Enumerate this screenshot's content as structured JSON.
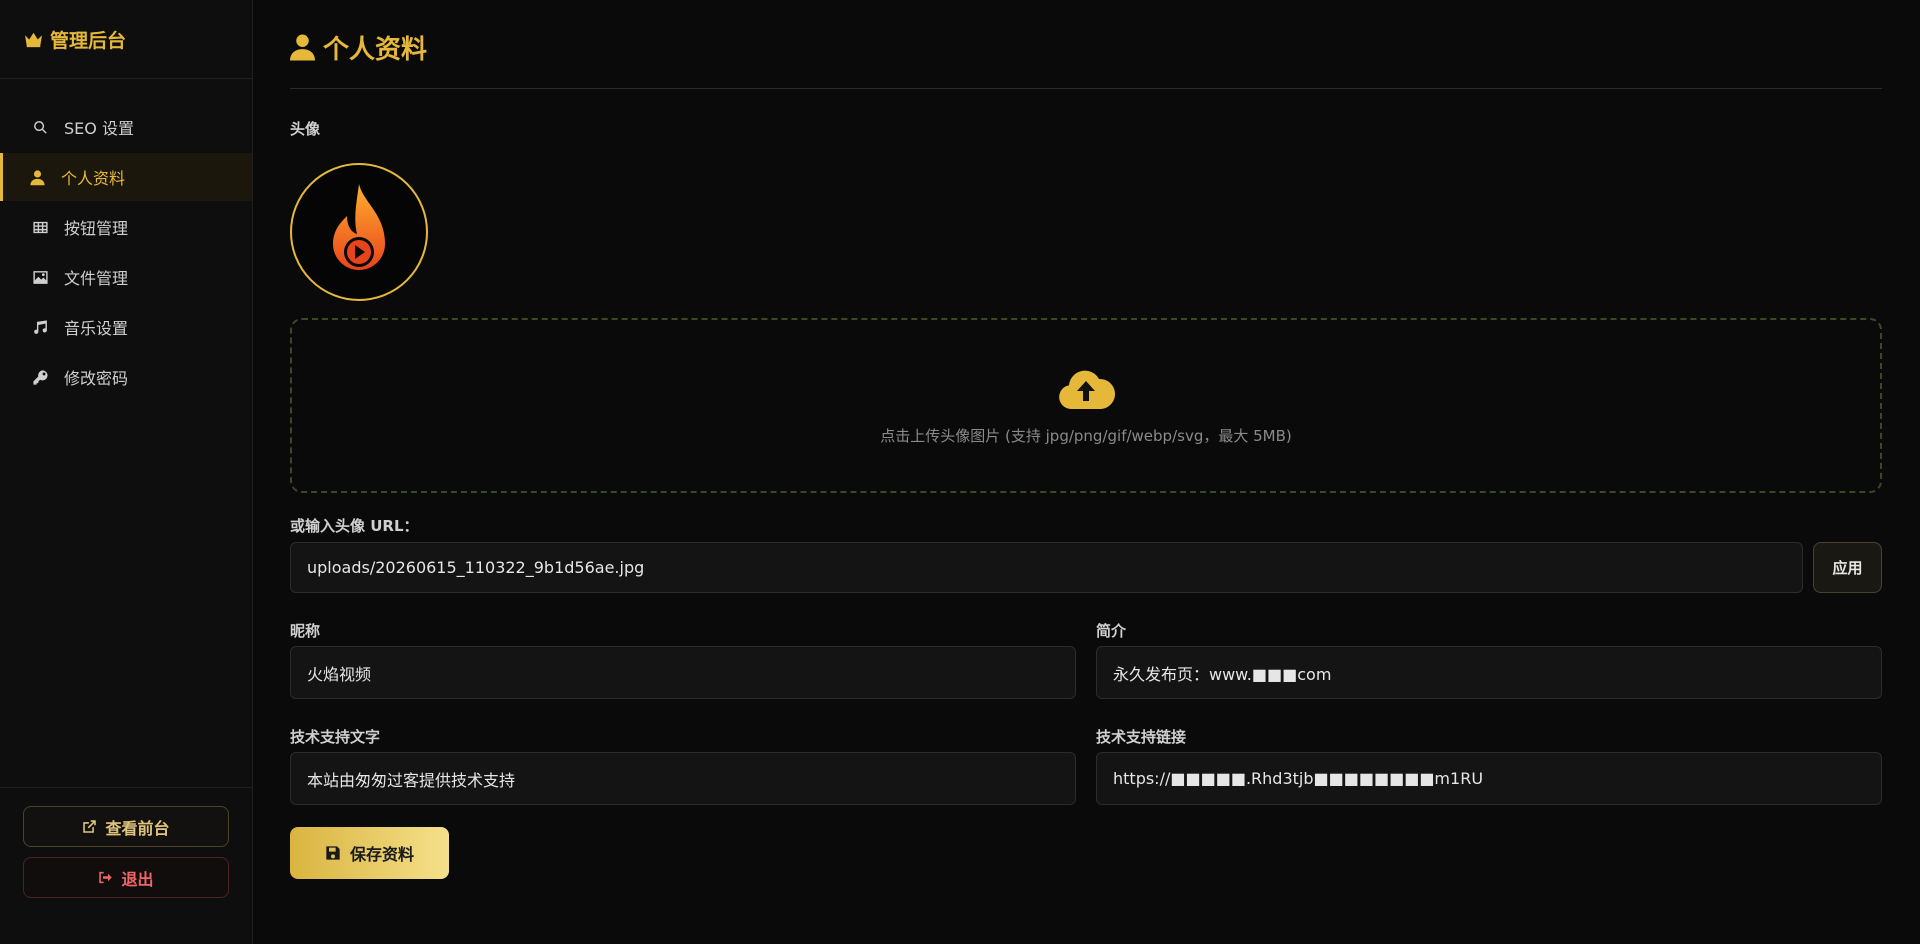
{
  "sidebar": {
    "brand": "管理后台",
    "items": [
      {
        "label": "SEO 设置",
        "icon": "search-icon"
      },
      {
        "label": "个人资料",
        "icon": "user-icon",
        "active": true
      },
      {
        "label": "按钮管理",
        "icon": "table-icon"
      },
      {
        "label": "文件管理",
        "icon": "image-icon"
      },
      {
        "label": "音乐设置",
        "icon": "music-icon"
      },
      {
        "label": "修改密码",
        "icon": "key-icon"
      }
    ],
    "view_front": "查看前台",
    "logout": "退出"
  },
  "page": {
    "title": "个人资料",
    "avatar_label": "头像",
    "upload_hint": "点击上传头像图片 (支持 jpg/png/gif/webp/svg，最大 5MB)",
    "url_label": "或输入头像 URL：",
    "url_value": "uploads/20260615_110322_9b1d56ae.jpg",
    "apply_label": "应用",
    "nickname_label": "昵称",
    "nickname_value": "火焰视频",
    "bio_label": "简介",
    "bio_value": "永久发布页：www.■■■com",
    "support_text_label": "技术支持文字",
    "support_text_value": "本站由匆匆过客提供技术支持",
    "support_link_label": "技术支持链接",
    "support_link_value": "https://■■■■■.Rhd3tjb■■■■■■■■m1RU",
    "save_label": "保存资料"
  },
  "colors": {
    "accent": "#e6b83a",
    "danger": "#f06565",
    "background": "#0a0a0a"
  }
}
